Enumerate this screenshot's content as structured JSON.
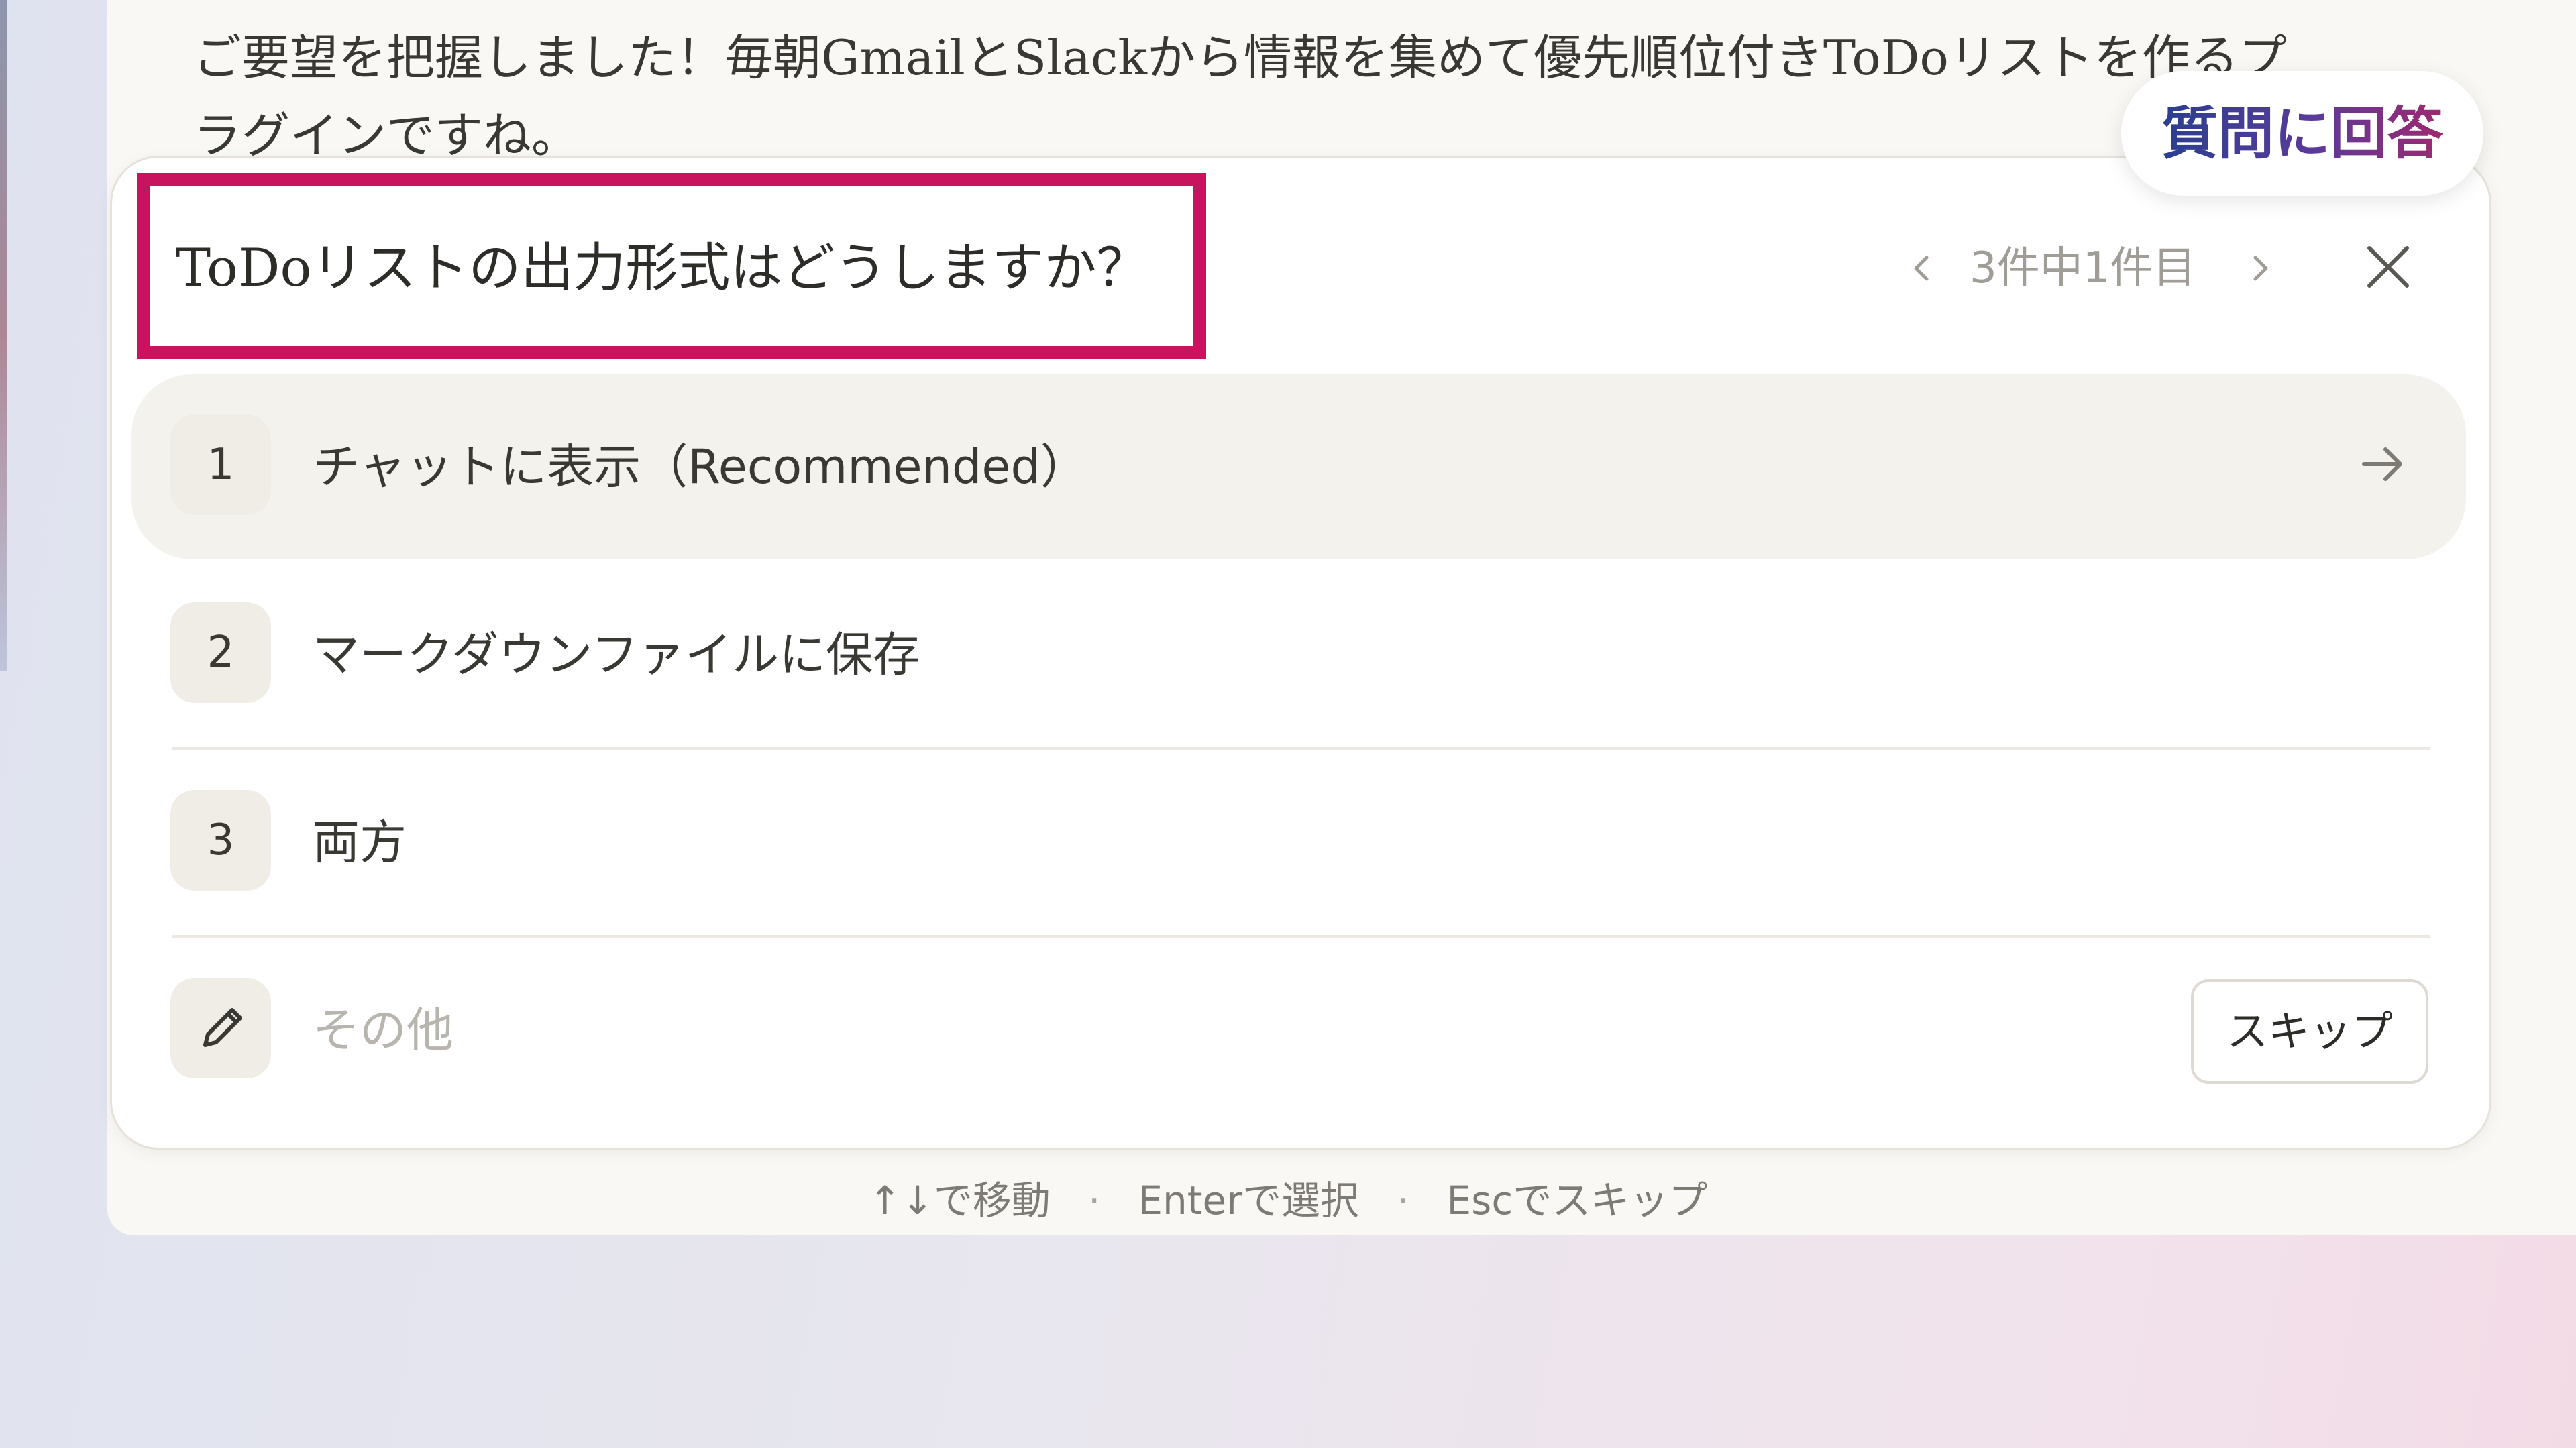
{
  "chat": {
    "message": "ご要望を把握しました！毎朝GmailとSlackから情報を集めて優先順位付きToDoリストを作るプラグインですね。"
  },
  "badge": {
    "label": "質問に回答"
  },
  "question": {
    "title": "ToDoリストの出力形式はどうしますか？",
    "pager_label": "3件中1件目",
    "prev_glyph": "‹",
    "next_glyph": "›"
  },
  "options": [
    {
      "number": "1",
      "label": "チャットに表示（Recommended）",
      "selected": true
    },
    {
      "number": "2",
      "label": "マークダウンファイルに保存",
      "selected": false
    },
    {
      "number": "3",
      "label": "両方",
      "selected": false
    }
  ],
  "other": {
    "placeholder": "その他",
    "icon": "pencil-icon"
  },
  "skip": {
    "label": "スキップ"
  },
  "hints": {
    "move": "↑↓で移動",
    "select": "Enterで選択",
    "skip": "Escでスキップ",
    "separator": "·"
  },
  "colors": {
    "highlight_border": "#c8135f",
    "badge_text_start": "#2a3f8f",
    "badge_text_end": "#a0286f",
    "selected_row_bg": "#f4f2ed"
  }
}
